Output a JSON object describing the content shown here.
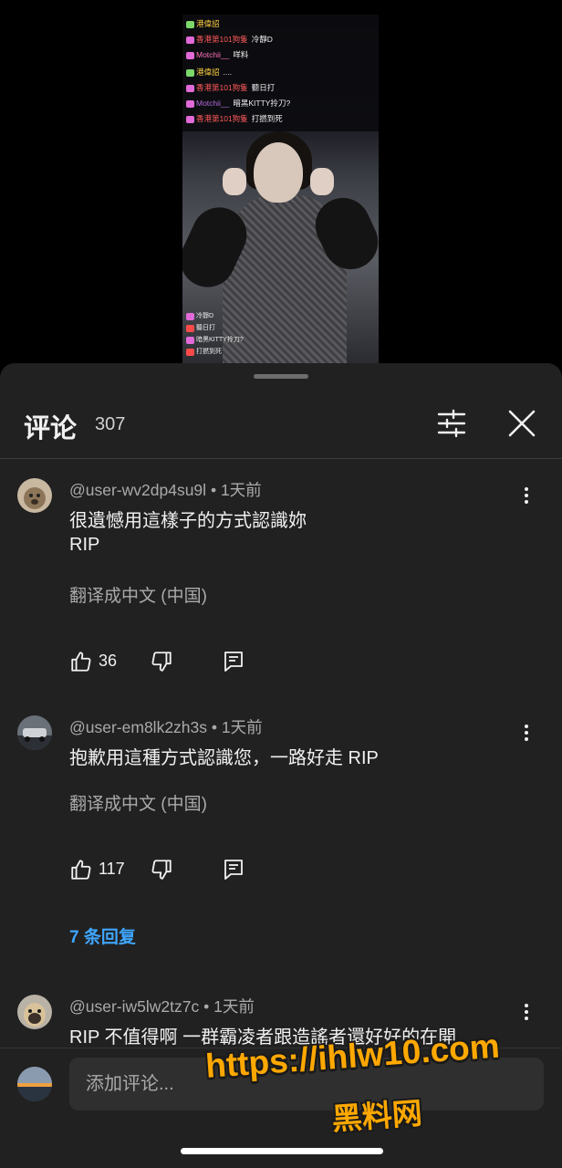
{
  "video": {
    "chat": [
      {
        "user": "港偉詔",
        "message": ""
      },
      {
        "user": "香港第101狗隻",
        "message": "冷靜D"
      },
      {
        "user": "Motchii__",
        "message": "咩料"
      },
      {
        "user": "港偉詔",
        "message": "...."
      },
      {
        "user": "香港第101狗隻",
        "message": "聽日打"
      },
      {
        "user": "Motchii__",
        "message": "暗黑KITTY拎刀?"
      },
      {
        "user": "香港第101狗隻",
        "message": "打撚到死"
      }
    ],
    "chat_bottom": [
      "冷靜D",
      "聽日打",
      "暗黑KITTY拎刀?",
      "打撚到死"
    ]
  },
  "sheet": {
    "title": "评论",
    "count": "307",
    "filter_icon": "tune-icon",
    "close_icon": "close-icon"
  },
  "comments": [
    {
      "author": "@user-wv2dp4su9l",
      "time": "1天前",
      "lines": [
        "很遺憾用這樣子的方式認識妳",
        "RIP"
      ],
      "translate": "翻译成中文 (中国)",
      "likes": "36"
    },
    {
      "author": "@user-em8lk2zh3s",
      "time": "1天前",
      "lines": [
        "抱歉用這種方式認識您，一路好走 RIP"
      ],
      "translate": "翻译成中文 (中国)",
      "likes": "117",
      "replies": "7 条回复"
    },
    {
      "author": "@user-iw5lw2tz7c",
      "time": "1天前",
      "lines": [
        "RIP 不值得啊 一群霸凌者跟造謠者還好好的在開"
      ]
    }
  ],
  "composer": {
    "placeholder": "添加评论..."
  },
  "watermark": {
    "url": "https://ihlw10.com",
    "name": "黑料网"
  },
  "colors": {
    "sheet_bg": "#212121",
    "link_blue": "#3ea6ff",
    "watermark": "#ffa800"
  }
}
